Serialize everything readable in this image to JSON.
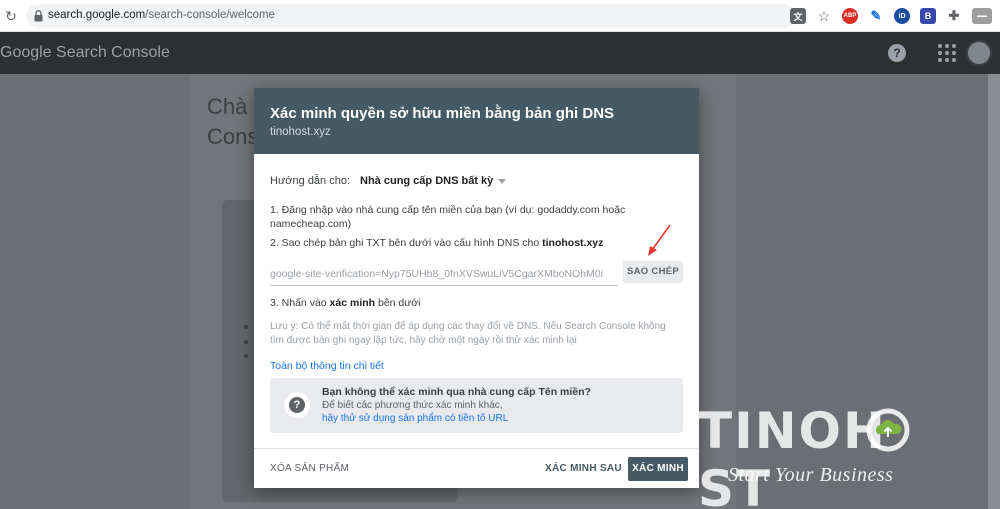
{
  "browser": {
    "url_host": "search.google.com",
    "url_path": "/search-console/welcome",
    "extension_icons": [
      "translate-icon",
      "star-icon",
      "adblock-icon",
      "feather-icon",
      "grammarly-icon",
      "bookmark-icon",
      "puzzle-icon",
      "extension-badge-icon"
    ]
  },
  "app": {
    "logo": "Google Search Console",
    "welcome_title_line1": "Chà",
    "welcome_title_line2": "Cons"
  },
  "dialog": {
    "title": "Xác minh quyền sở hữu miền bằng bản ghi DNS",
    "domain": "tinohost.xyz",
    "guide_label": "Hướng dẫn cho:",
    "guide_value": "Nhà cung cấp DNS bất kỳ",
    "step1": "1. Đăng nhập vào nhà cung cấp tên miền của bạn (ví dụ: godaddy.com hoặc namecheap.com)",
    "step2_prefix": "2. Sao chép bản ghi TXT bên dưới vào cấu hình DNS cho ",
    "step2_domain": "tinohost.xyz",
    "txt_record": "google-site-verification=Nyp75UHb8_0fnXVSwuLiV5CgarXMboNOhM0i",
    "copy_label": "SAO CHÉP",
    "step3_prefix": "3. Nhấn vào ",
    "step3_bold": "xác minh",
    "step3_suffix": " bên dưới",
    "note": "Lưu ý: Có thể mất thời gian để áp dụng các thay đổi về DNS. Nếu Search Console không tìm được bản ghi ngay lập tức, hãy chờ một ngày rồi thử xác minh lại",
    "details_link": "Toàn bộ thông tin chi tiết",
    "alt_title": "Bạn không thể xác minh qua nhà cung cấp Tên miền?",
    "alt_text": "Để biết các phương thức xác minh khác,",
    "alt_link": "hãy thử sử dụng sản phẩm có tiền tố URL",
    "delete_label": "XÓA SẢN PHẨM",
    "later_label": "XÁC MINH SAU",
    "verify_label": "XÁC MINH"
  },
  "watermark": {
    "brand_left": "TINOH",
    "brand_right": "ST",
    "tagline": "Start Your Business"
  },
  "colors": {
    "dialog_header": "#455a64",
    "link": "#1a73e8",
    "annotation_arrow": "#e53935"
  }
}
